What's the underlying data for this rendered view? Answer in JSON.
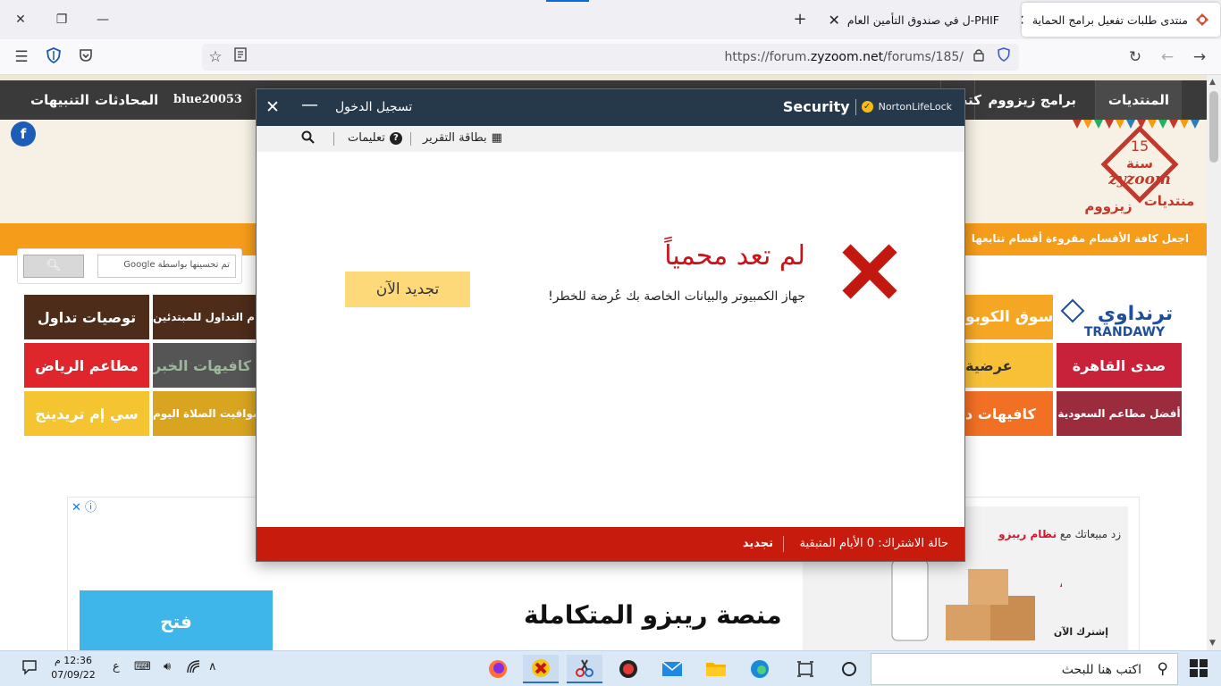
{
  "browser": {
    "tabs": [
      {
        "title": "منتدى طلبات تفعيل برامج الحماية",
        "active": true
      },
      {
        "title": "PHIF-ل في صندوق التأمين العام",
        "active": false
      }
    ],
    "url_prefix": "https://forum.",
    "url_domain": "zyzoom.net",
    "url_path": "/forums/185/"
  },
  "site": {
    "nav": [
      "المنتديات",
      "برامج زيزووم",
      "كتب",
      "blue20053",
      "المحادثات",
      "التنبيهات"
    ],
    "facebook_glyph": "f",
    "logo": {
      "top": "15",
      "mid": "سنة",
      "brand": "zyzoom",
      "arabic1": "منتديات",
      "arabic2": "زيزووم"
    },
    "orange_links": [
      "اجعل كافة الأقسام مقروءة",
      "أقسام تتابعها"
    ],
    "google_search": {
      "placeholder": "تم تحسينها بواسطة Google",
      "button_icon": "search-icon"
    },
    "tiles": [
      {
        "label": "ترنداوي TRANDAWY",
        "color": "#ffffff"
      },
      {
        "label": "سوق الكوبو",
        "color": "#f5a623"
      },
      {
        "label": "صدى القاهرة",
        "color": "#c7223a"
      },
      {
        "label": "عرضية",
        "color": "#f8c037"
      },
      {
        "label": "أفضل مطاعم السعودية",
        "color": "#9b2c3e"
      },
      {
        "label": "كافيهات د",
        "color": "#f27024"
      },
      {
        "label": "توصيات تداول",
        "color": "#4d2c19"
      },
      {
        "label": "م التداول للمبتدئين",
        "color": "#4d2c19"
      },
      {
        "label": "مطاعم الرياض",
        "color": "#e0262d"
      },
      {
        "label": "كافيهات الخبر",
        "color": "#555555"
      },
      {
        "label": "سي إم تريدينج",
        "color": "#f4c531"
      },
      {
        "label": "مواقيت الصلاة اليوم",
        "color": "#d9a520"
      }
    ],
    "ad": {
      "open_button": "فتح",
      "title": "منصة ريبزو المتكاملة",
      "promo_prefix": "زد مبيعاتك مع",
      "promo_highlight": "نظام ريبزو",
      "subscribe": "إشترك الآن"
    }
  },
  "norton": {
    "title_signin": "تسجيل الدخول",
    "brand_security": "Security",
    "brand_lifelock": "NortonLifeLock",
    "menu_report": "بطاقة التقرير",
    "menu_help": "تعليمات",
    "heading": "لم تعد محمياً",
    "message": "جهاز الكمبيوتر والبيانات الخاصة بك عُرضة للخطر!",
    "renew_button": "تجديد الآن",
    "status_label": "حالة الاشتراك:",
    "status_value": "0 الأيام المتبقية",
    "status_renew": "تجديد",
    "status_color": "#c61b0d",
    "title_color": "#26394b",
    "renew_color": "#fed97a"
  },
  "taskbar": {
    "search_placeholder": "اكتب هنا للبحث",
    "time": "12:36 م",
    "date": "07/09/22",
    "lang": "ع"
  }
}
